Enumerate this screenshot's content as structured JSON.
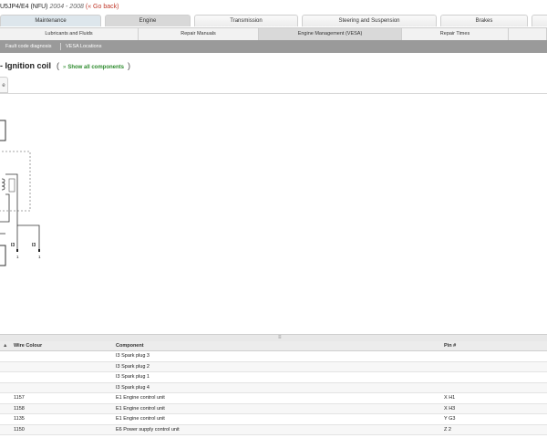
{
  "header": {
    "model": "U5JP4/E4 (NFU)",
    "years": "2004 - 2008",
    "go_back": "(« Go back)"
  },
  "main_tabs": [
    {
      "label": "Maintenance",
      "active": false
    },
    {
      "label": "Engine",
      "active": true
    },
    {
      "label": "Transmission",
      "active": false
    },
    {
      "label": "Steering and Suspension",
      "active": false
    },
    {
      "label": "Brakes",
      "active": false
    }
  ],
  "sub_tabs": [
    {
      "label": "Lubricants and Fluids",
      "active": false
    },
    {
      "label": "Repair Manuals",
      "active": false
    },
    {
      "label": "Engine Management (VESA)",
      "active": true
    },
    {
      "label": "Repair Times",
      "active": false
    }
  ],
  "tool_tabs": [
    {
      "label": "Fault code diagnosis"
    },
    {
      "label": "VESA Locations"
    }
  ],
  "page": {
    "title": "- Ignition coil",
    "paren_open": "(",
    "show_all_arrow": "»",
    "show_all": "Show all components",
    "paren_close": ")"
  },
  "subtab": {
    "label": "e"
  },
  "diagram": {
    "labels": [
      "I3",
      "I3"
    ],
    "pin_labels": [
      "1",
      "1"
    ]
  },
  "table": {
    "sort_icon": "▲",
    "headers": {
      "wire": "Wire Colour",
      "component": "Component",
      "pin": "Pin #"
    },
    "rows": [
      {
        "wire": "",
        "component": "I3 Spark plug 3",
        "pin": ""
      },
      {
        "wire": "",
        "component": "I3 Spark plug 2",
        "pin": ""
      },
      {
        "wire": "",
        "component": "I3 Spark plug 1",
        "pin": ""
      },
      {
        "wire": "",
        "component": "I3 Spark plug 4",
        "pin": ""
      },
      {
        "wire": "1157",
        "component": "E1 Engine control unit",
        "pin": "X H1"
      },
      {
        "wire": "1158",
        "component": "E1 Engine control unit",
        "pin": "X H3"
      },
      {
        "wire": "1135",
        "component": "E1 Engine control unit",
        "pin": "Y G3"
      },
      {
        "wire": "1150",
        "component": "E6 Power supply control unit",
        "pin": "Z 2"
      }
    ]
  }
}
